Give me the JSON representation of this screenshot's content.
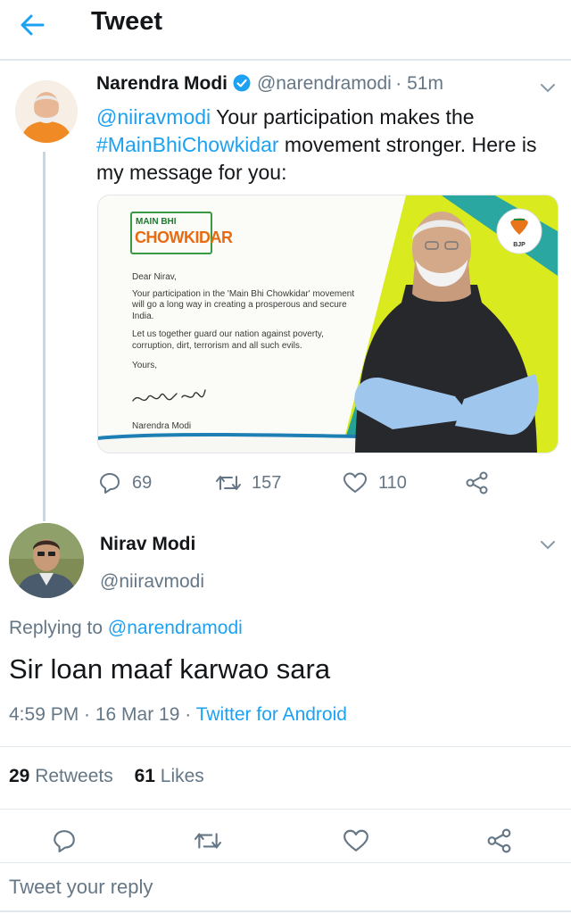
{
  "header": {
    "title": "Tweet"
  },
  "quoted_tweet": {
    "author_name": "Narendra Modi",
    "author_handle": "@narendramodi",
    "time_ago": "· 51m",
    "mention": "@niiravmodi",
    "text_part1": " Your participation makes the ",
    "hashtag": "#MainBhiChowkidar",
    "text_part2": " movement stronger. Here is my message for you:",
    "card": {
      "logo_top": "MAIN BHI",
      "logo_main": "CHOWKIDAR",
      "greeting": "Dear Nirav,",
      "para1": "Your participation in the 'Main Bhi Chowkidar' movement will go a long way in creating a prosperous and secure India.",
      "para2": "Let us together guard our nation against poverty, corruption, dirt, terrorism and all such evils.",
      "closing": "Yours,",
      "signature_name": "Narendra Modi",
      "party_badge": "BJP"
    },
    "replies": "69",
    "retweets": "157",
    "likes": "110"
  },
  "reply_tweet": {
    "author_name": "Nirav Modi",
    "author_handle": "@niiravmodi",
    "replying_prefix": "Replying to ",
    "replying_to": "@narendramodi",
    "text": "Sir loan maaf karwao sara",
    "timestamp": "4:59 PM · 16 Mar 19 · ",
    "client": "Twitter for Android",
    "retweet_count": "29",
    "retweet_label": " Retweets",
    "like_count": "61",
    "like_label": " Likes"
  },
  "reply_box": {
    "placeholder": "Tweet your reply"
  },
  "colors": {
    "accent": "#1da1f2",
    "muted": "#657786",
    "divider": "#e1e8ed"
  }
}
